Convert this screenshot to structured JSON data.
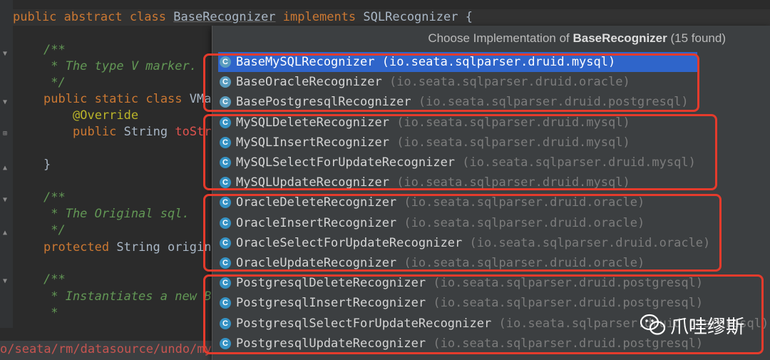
{
  "editor": {
    "lines": {
      "l0": {
        "kw1": "public",
        "kw2": "abstract",
        "kw3": "class",
        "cls": "BaseRecognizer",
        "kw4": "implements",
        "iface": "SQLRecognizer",
        "brace": "{"
      },
      "l1": "/**",
      "l2": " * The type V marker.",
      "l3": " */",
      "l4": {
        "kw1": "public",
        "kw2": "static",
        "kw3": "class",
        "cls": "VMa"
      },
      "l5": "@Override",
      "l6": {
        "kw": "public",
        "type": "String",
        "m": "toStr"
      },
      "l7": "}",
      "l8": "/**",
      "l9": " * The Original sql.",
      "l10": " */",
      "l11": {
        "kw": "protected",
        "type": "String",
        "name": "origin"
      },
      "l12": "/**",
      "l13": " * Instantiates a new B",
      "l14": " *"
    },
    "status_path": "o/seata/rm/datasource/undo/mysql/MySQLUndoLogManager.java"
  },
  "popup": {
    "title_prefix": "Choose Implementation of ",
    "title_class": "BaseRecognizer",
    "title_suffix": " (15 found)",
    "items": [
      {
        "name": "BaseMySQLRecognizer",
        "pkg": "(io.seata.sqlparser.druid.mysql)",
        "icon": "C"
      },
      {
        "name": "BaseOracleRecognizer",
        "pkg": "(io.seata.sqlparser.druid.oracle)",
        "icon": "C"
      },
      {
        "name": "BasePostgresqlRecognizer",
        "pkg": "(io.seata.sqlparser.druid.postgresql)",
        "icon": "C"
      },
      {
        "name": "MySQLDeleteRecognizer",
        "pkg": "(io.seata.sqlparser.druid.mysql)",
        "icon": "C"
      },
      {
        "name": "MySQLInsertRecognizer",
        "pkg": "(io.seata.sqlparser.druid.mysql)",
        "icon": "C"
      },
      {
        "name": "MySQLSelectForUpdateRecognizer",
        "pkg": "(io.seata.sqlparser.druid.mysql)",
        "icon": "C"
      },
      {
        "name": "MySQLUpdateRecognizer",
        "pkg": "(io.seata.sqlparser.druid.mysql)",
        "icon": "C"
      },
      {
        "name": "OracleDeleteRecognizer",
        "pkg": "(io.seata.sqlparser.druid.oracle)",
        "icon": "C"
      },
      {
        "name": "OracleInsertRecognizer",
        "pkg": "(io.seata.sqlparser.druid.oracle)",
        "icon": "C"
      },
      {
        "name": "OracleSelectForUpdateRecognizer",
        "pkg": "(io.seata.sqlparser.druid.oracle)",
        "icon": "C"
      },
      {
        "name": "OracleUpdateRecognizer",
        "pkg": "(io.seata.sqlparser.druid.oracle)",
        "icon": "C"
      },
      {
        "name": "PostgresqlDeleteRecognizer",
        "pkg": "(io.seata.sqlparser.druid.postgresql)",
        "icon": "C"
      },
      {
        "name": "PostgresqlInsertRecognizer",
        "pkg": "(io.seata.sqlparser.druid.postgresql)",
        "icon": "C"
      },
      {
        "name": "PostgresqlSelectForUpdateRecognizer",
        "pkg": "(io.seata.sqlparser.druid.postgresql)",
        "icon": "C"
      },
      {
        "name": "PostgresqlUpdateRecognizer",
        "pkg": "(io.seata.sqlparser.druid.postgresql)",
        "icon": "C"
      }
    ],
    "selected_index": 0
  },
  "watermark": {
    "text": "爪哇缪斯",
    "icon": "wechat-icon"
  },
  "colors": {
    "highlight_box": "#e53b2c",
    "selection": "#2f65ca",
    "class_icon": "#3592c4"
  }
}
